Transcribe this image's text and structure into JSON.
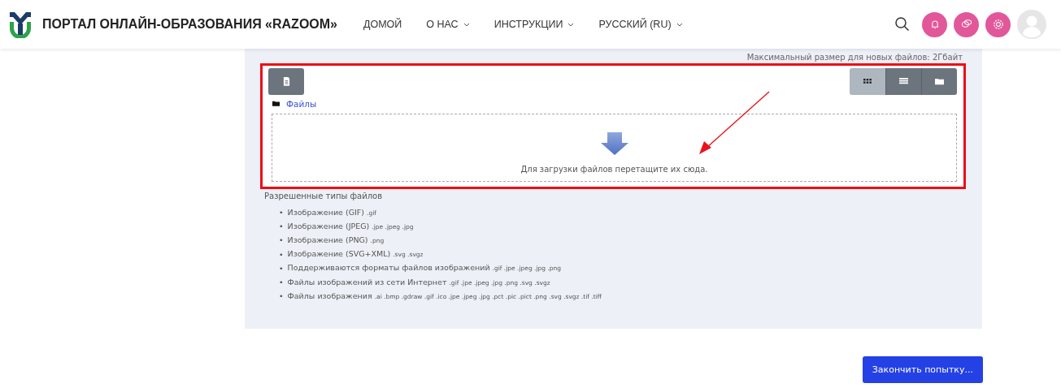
{
  "header": {
    "site_title": "ПОРТАЛ ОНЛАЙН-ОБРАЗОВАНИЯ «RAZOOM»",
    "nav": [
      {
        "label": "ДОМОЙ",
        "dropdown": false
      },
      {
        "label": "О НАС",
        "dropdown": true
      },
      {
        "label": "ИНСТРУКЦИИ",
        "dropdown": true
      },
      {
        "label": "РУССКИЙ (RU)",
        "dropdown": true
      }
    ]
  },
  "file_manager": {
    "max_size": "Максимальный размер для новых файлов: 2Гбайт",
    "view_buttons": [
      {
        "kind": "icons",
        "selected": true
      },
      {
        "kind": "list",
        "selected": false
      },
      {
        "kind": "tree",
        "selected": false
      }
    ],
    "path": "Файлы",
    "drop_hint": "Для загрузки файлов перетащите их сюда."
  },
  "allowed": {
    "title": "Разрешенные типы файлов",
    "items": [
      {
        "bullet": "•",
        "name": "Изображение (GIF)",
        "ext": ".gif"
      },
      {
        "bullet": "•",
        "name": "Изображение (JPEG)",
        "ext": ".jpe .jpeg .jpg"
      },
      {
        "bullet": "•",
        "name": "Изображение (PNG)",
        "ext": ".png"
      },
      {
        "bullet": "•",
        "name": "Изображение (SVG+XML)",
        "ext": ".svg .svgz"
      },
      {
        "bullet": "•",
        "name": "Поддерживаются форматы файлов изображений",
        "ext": ".gif .jpe .jpeg .jpg .png"
      },
      {
        "bullet": "•",
        "name": "Файлы изображений из сети Интернет",
        "ext": ".gif .jpe .jpeg .jpg .png .svg .svgz"
      },
      {
        "bullet": "•",
        "name": "Файлы изображения",
        "ext": ".ai .bmp .gdraw .gif .ico .jpe .jpeg .jpg .pct .pic .pict .png .svg .svgz .tif .tiff"
      }
    ]
  },
  "finish_button": "Закончить попытку..."
}
